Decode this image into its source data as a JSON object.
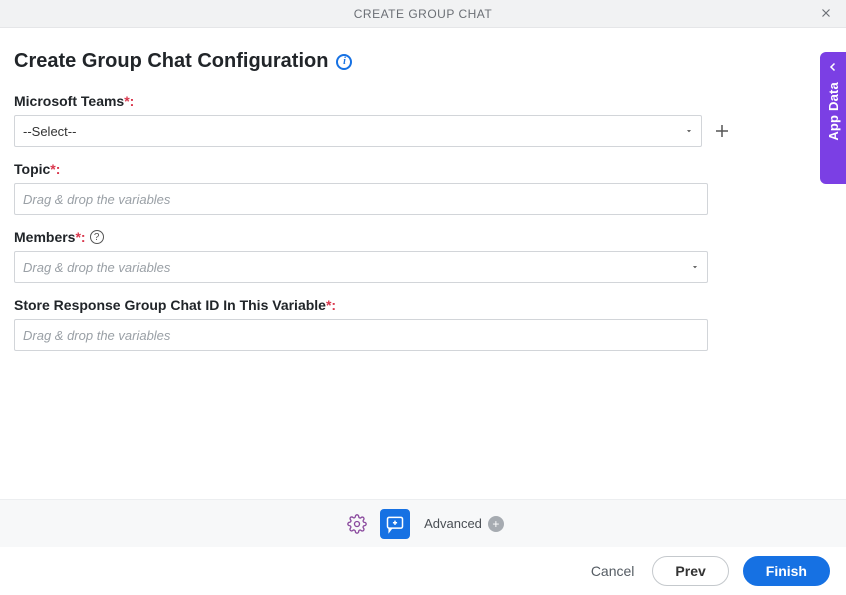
{
  "header": {
    "title": "CREATE GROUP CHAT"
  },
  "page": {
    "title": "Create Group Chat Configuration"
  },
  "side_tab": {
    "label": "App Data"
  },
  "fields": {
    "teams": {
      "label": "Microsoft Teams",
      "required_suffix": "*:",
      "selected": "--Select--",
      "options": [
        "--Select--"
      ]
    },
    "topic": {
      "label": "Topic",
      "required_suffix": "*:",
      "placeholder": "Drag & drop the variables",
      "value": ""
    },
    "members": {
      "label": "Members",
      "required_suffix": "*:",
      "placeholder": "Drag & drop the variables",
      "value": ""
    },
    "store_var": {
      "label": "Store Response Group Chat ID In This Variable",
      "required_suffix": "*:",
      "placeholder": "Drag & drop the variables",
      "value": ""
    }
  },
  "toolbar": {
    "advanced": "Advanced"
  },
  "footer": {
    "cancel": "Cancel",
    "prev": "Prev",
    "finish": "Finish"
  }
}
